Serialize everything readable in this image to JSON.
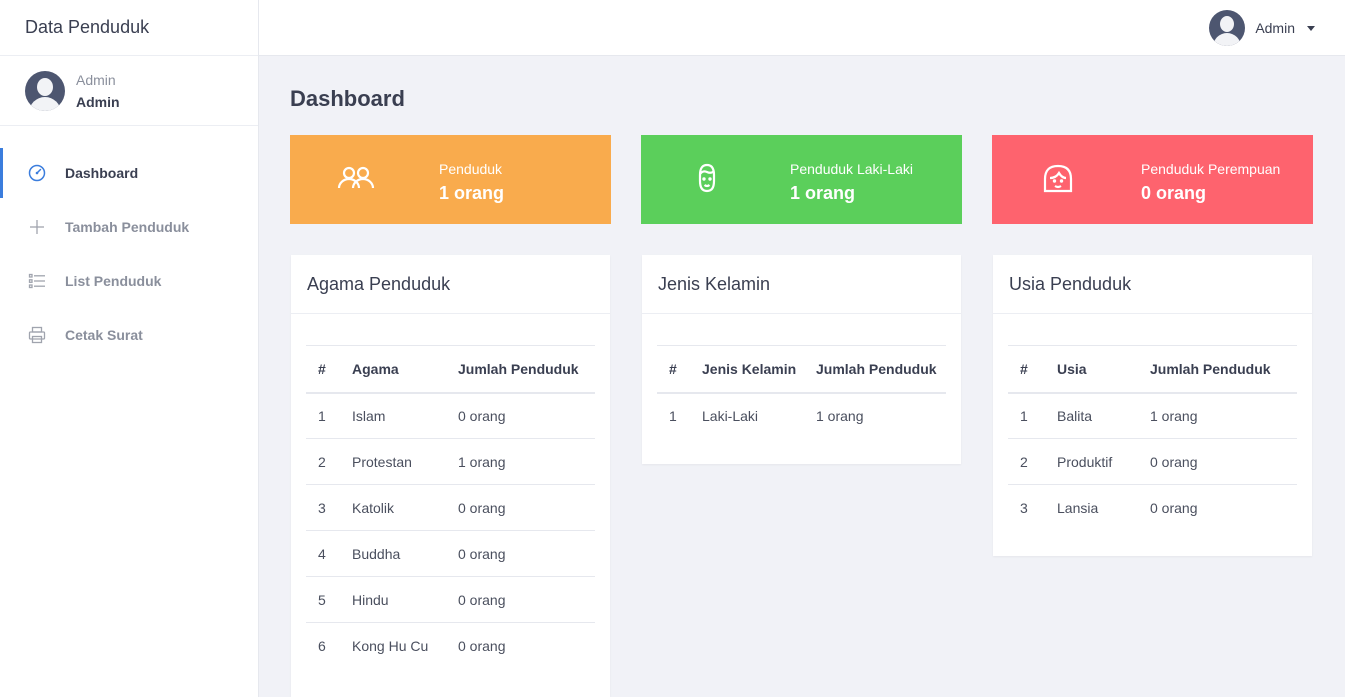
{
  "brand": "Data Penduduk",
  "user": {
    "role": "Admin",
    "name": "Admin"
  },
  "topbar": {
    "user_name": "Admin"
  },
  "nav": [
    {
      "label": "Dashboard",
      "icon": "dashboard-gauge-icon"
    },
    {
      "label": "Tambah Penduduk",
      "icon": "plus-icon"
    },
    {
      "label": "List Penduduk",
      "icon": "list-icon"
    },
    {
      "label": "Cetak Surat",
      "icon": "printer-icon"
    }
  ],
  "page_title": "Dashboard",
  "stats": [
    {
      "label": "Penduduk",
      "value": "1 orang",
      "color": "#f9ab4d",
      "icon": "users-icon"
    },
    {
      "label": "Penduduk Laki-Laki",
      "value": "1 orang",
      "color": "#5bcf5b",
      "icon": "male-face-icon"
    },
    {
      "label": "Penduduk Perempuan",
      "value": "0 orang",
      "color": "#fe636e",
      "icon": "female-face-icon"
    }
  ],
  "agama": {
    "title": "Agama Penduduk",
    "headers": [
      "#",
      "Agama",
      "Jumlah Penduduk"
    ],
    "rows": [
      [
        "1",
        "Islam",
        "0 orang"
      ],
      [
        "2",
        "Protestan",
        "1 orang"
      ],
      [
        "3",
        "Katolik",
        "0 orang"
      ],
      [
        "4",
        "Buddha",
        "0 orang"
      ],
      [
        "5",
        "Hindu",
        "0 orang"
      ],
      [
        "6",
        "Kong Hu Cu",
        "0 orang"
      ]
    ]
  },
  "kelamin": {
    "title": "Jenis Kelamin",
    "headers": [
      "#",
      "Jenis Kelamin",
      "Jumlah Penduduk"
    ],
    "rows": [
      [
        "1",
        "Laki-Laki",
        "1 orang"
      ]
    ]
  },
  "usia": {
    "title": "Usia Penduduk",
    "headers": [
      "#",
      "Usia",
      "Jumlah Penduduk"
    ],
    "rows": [
      [
        "1",
        "Balita",
        "1 orang"
      ],
      [
        "2",
        "Produktif",
        "0 orang"
      ],
      [
        "3",
        "Lansia",
        "0 orang"
      ]
    ]
  }
}
